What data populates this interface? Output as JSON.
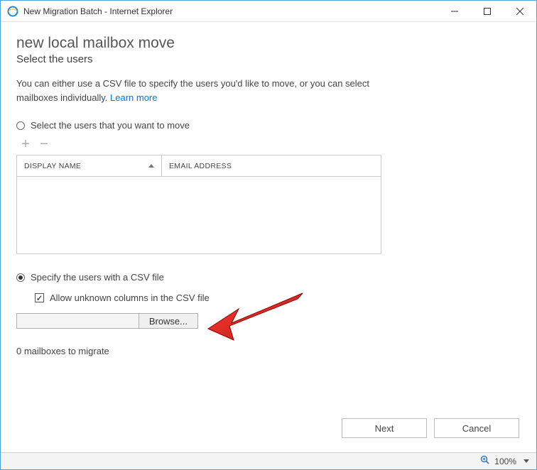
{
  "window": {
    "title": "New Migration Batch - Internet Explorer"
  },
  "page": {
    "heading": "new local mailbox move",
    "subheading": "Select the users",
    "intro_text": "You can either use a CSV file to specify the users you'd like to move, or you can select mailboxes individually. ",
    "learn_more": "Learn more"
  },
  "options": {
    "select_users_label": "Select the users that you want to move",
    "csv_label": "Specify the users with a CSV file",
    "allow_unknown_label": "Allow unknown columns in the CSV file",
    "browse_label": "Browse...",
    "browse_path": ""
  },
  "grid": {
    "col_display_name": "DISPLAY NAME",
    "col_email": "EMAIL ADDRESS"
  },
  "status": {
    "mailboxes_count": "0 mailboxes to migrate"
  },
  "buttons": {
    "next": "Next",
    "cancel": "Cancel"
  },
  "statusbar": {
    "zoom": "100%"
  }
}
